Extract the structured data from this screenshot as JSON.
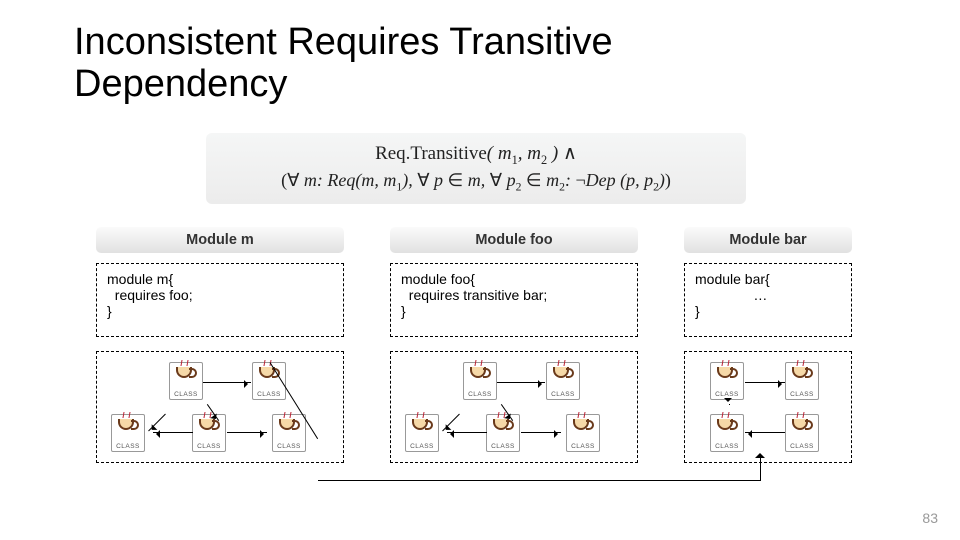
{
  "title": "Inconsistent Requires Transitive\nDependency",
  "formula": {
    "line1_html": "<span class='op'>Req.Transitive</span>( m<span class='sub'>1</span>, m<span class='sub'>2</span> ) <span class='op'>&and;</span>",
    "line2_html": "<span class='op'>(&forall;</span> m: Req(m, m<span class='sub'>1</span>), <span class='op'>&forall;</span> p <span class='op'>&isin;</span> m, <span class='op'>&forall;</span> p<span class='sub'>2</span> <span class='op'>&isin;</span> m<span class='sub'>2</span>: <span class='op'>&not;</span>Dep (p, p<span class='sub'>2</span>)<span class='op'>)</span>"
  },
  "modules": [
    {
      "header": "Module m",
      "code": "module m{\n  requires foo;\n}",
      "class_icon_label": "CLASS"
    },
    {
      "header": "Module foo",
      "code": "module foo{\n  requires transitive bar;\n}",
      "class_icon_label": "CLASS"
    },
    {
      "header": "Module bar",
      "code": "module bar{\n               …\n}",
      "class_icon_label": "CLASS"
    }
  ],
  "page_number": "83"
}
